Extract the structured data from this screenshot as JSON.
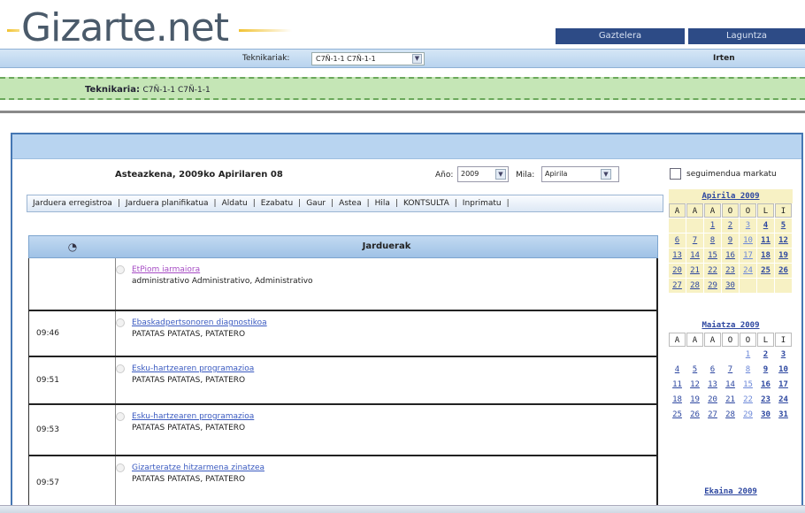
{
  "header": {
    "logo": "Gizarte.net",
    "links": [
      "Gaztelera",
      "Laguntza"
    ]
  },
  "techbar": {
    "label": "Teknikariak:",
    "selected": "C7Ñ-1-1 C7Ñ-1-1",
    "logout": "Irten"
  },
  "tech_banner": {
    "label": "Teknikaria:",
    "value": "C7Ñ-1-1 C7Ñ-1-1"
  },
  "main": {
    "date_title": "Asteazkena, 2009ko Apirilaren 08",
    "year_label": "Año:",
    "year_value": "2009",
    "month_label": "Mila:",
    "month_value": "Apirila",
    "toolbar": [
      "Jarduera erregistroa",
      "Jarduera planifikatua",
      "Aldatu",
      "Ezabatu",
      "Gaur",
      "Astea",
      "Hila",
      "KONTSULTA",
      "Inprimatu"
    ],
    "table_header": "Jarduerak",
    "rows": [
      {
        "time": "",
        "title": "EtPiom iarmaiora",
        "who": "administrativo Administrativo, Administrativo",
        "visited": true
      },
      {
        "time": "09:46",
        "title": "Ebaskadpertsonoren diagnostikoa",
        "who": "PATATAS PATATAS, PATATERO",
        "visited": false
      },
      {
        "time": "09:51",
        "title": "Esku-hartzearen programazioa",
        "who": "PATATAS PATATAS, PATATERO",
        "visited": false
      },
      {
        "time": "09:53",
        "title": "Esku-hartzearen programazioa",
        "who": "PATATAS PATATAS, PATATERO",
        "visited": false
      },
      {
        "time": "09:57",
        "title": "Gizarteratze hitzarmena zinatzea",
        "who": "PATATAS PATATAS, PATATERO",
        "visited": false
      }
    ]
  },
  "sidebar": {
    "checkbox_label": "seguimendua markatu",
    "weekday_headers": [
      "A",
      "A",
      "A",
      "O",
      "O",
      "L",
      "I"
    ],
    "calendars": [
      {
        "title": "Apirila 2009",
        "cells": [
          "",
          "",
          "1",
          "2",
          "3",
          "4",
          "5",
          "6",
          "7",
          "8",
          "9",
          "10",
          "11",
          "12",
          "13",
          "14",
          "15",
          "16",
          "17",
          "18",
          "19",
          "20",
          "21",
          "22",
          "23",
          "24",
          "25",
          "26",
          "27",
          "28",
          "29",
          "30",
          "",
          "",
          ""
        ]
      },
      {
        "title": "Maiatza 2009",
        "cells": [
          "",
          "",
          "",
          "",
          "1",
          "2",
          "3",
          "4",
          "5",
          "6",
          "7",
          "8",
          "9",
          "10",
          "11",
          "12",
          "13",
          "14",
          "15",
          "16",
          "17",
          "18",
          "19",
          "20",
          "21",
          "22",
          "23",
          "24",
          "25",
          "26",
          "27",
          "28",
          "29",
          "30",
          "31"
        ]
      },
      {
        "title": "Ekaina 2009",
        "cells": []
      }
    ]
  },
  "colors": {
    "brand_blue": "#2d4b86",
    "header_bar": "#b8d4f0",
    "green_bar": "#c5e6b6",
    "calendar_highlight": "#f7f1c4"
  }
}
